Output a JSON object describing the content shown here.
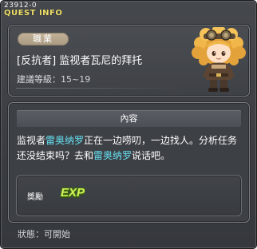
{
  "header": {
    "quest_id": "23912-0",
    "title": "QUEST INFO"
  },
  "quest": {
    "job_label": "職業",
    "title": "[反抗者] 监视者瓦尼的拜托",
    "level_label": "建議等級：",
    "level_range": "15~19",
    "character_icon": "npc-character-portrait"
  },
  "content": {
    "header": "內容",
    "text_parts": [
      "监视者",
      "雷奥纳罗",
      "正在一边唠叨，一边找人。分析任务还没结束吗？去和",
      "雷奥纳罗",
      "说话吧。"
    ]
  },
  "reward": {
    "label": "獎勵",
    "exp_text": "EXP"
  },
  "status": {
    "text": "狀態：可開始"
  },
  "colors": {
    "npc_highlight": "#66e0f2",
    "title_yellow": "#f0e06a",
    "exp_green": "#d6f25a"
  }
}
